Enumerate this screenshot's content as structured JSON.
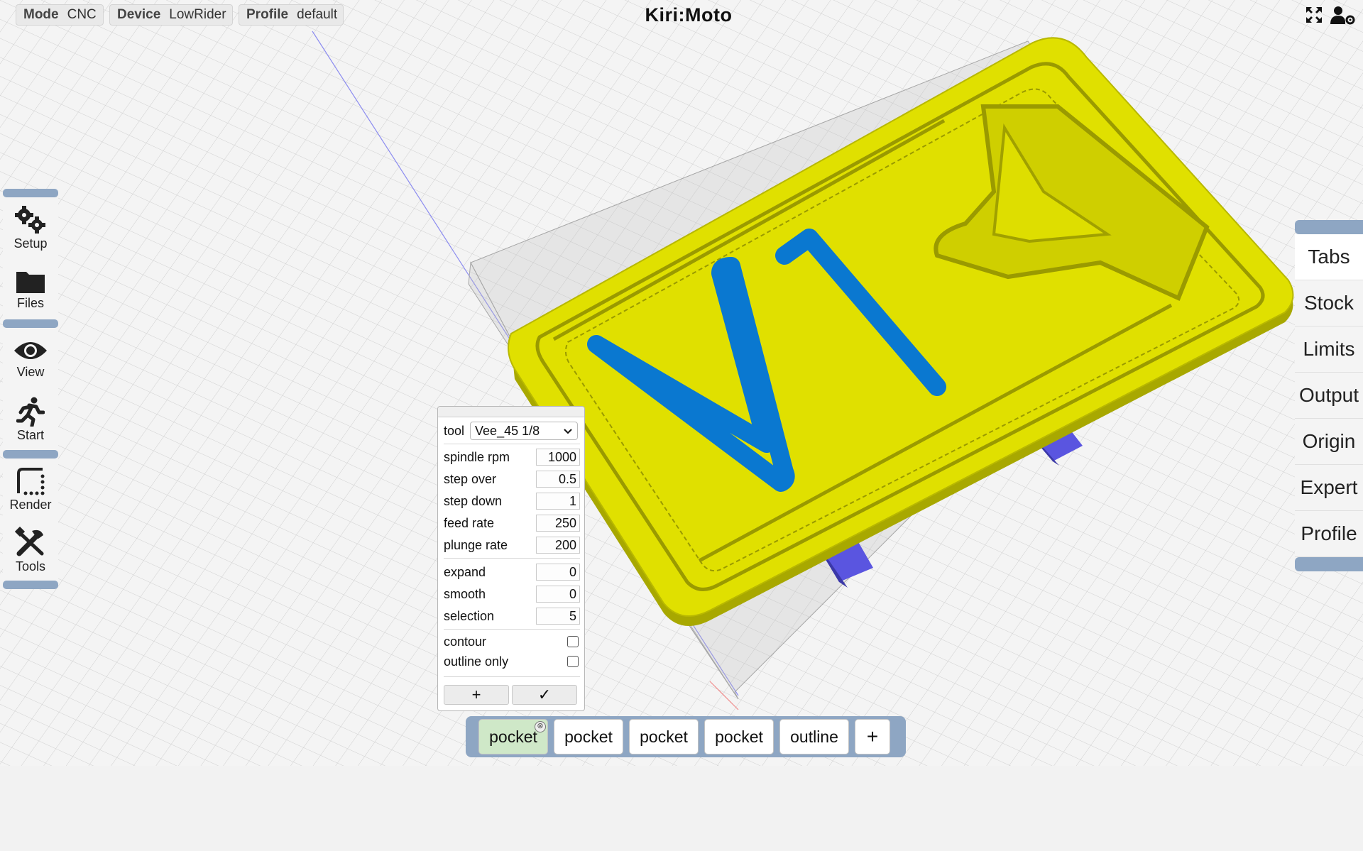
{
  "app": {
    "title": "Kiri:Moto"
  },
  "topbar": {
    "mode": {
      "label": "Mode",
      "value": "CNC"
    },
    "device": {
      "label": "Device",
      "value": "LowRider"
    },
    "profile": {
      "label": "Profile",
      "value": "default"
    },
    "icons": [
      "fullscreen-icon",
      "user-settings-icon"
    ]
  },
  "leftnav": {
    "items": [
      {
        "label": "Setup",
        "icon": "gears-icon"
      },
      {
        "label": "Files",
        "icon": "folder-icon"
      },
      {
        "label": "View",
        "icon": "eye-icon"
      },
      {
        "label": "Start",
        "icon": "running-icon"
      },
      {
        "label": "Render",
        "icon": "render-icon"
      },
      {
        "label": "Tools",
        "icon": "tools-icon"
      }
    ]
  },
  "rightnav": {
    "items": [
      "Tabs",
      "Stock",
      "Limits",
      "Output",
      "Origin",
      "Expert",
      "Profile"
    ]
  },
  "panel": {
    "tool_label": "tool",
    "tool_value": "Vee_45 1/8",
    "fields": [
      {
        "label": "spindle rpm",
        "value": "1000"
      },
      {
        "label": "step over",
        "value": "0.5"
      },
      {
        "label": "step down",
        "value": "1"
      },
      {
        "label": "feed rate",
        "value": "250"
      },
      {
        "label": "plunge rate",
        "value": "200"
      },
      {
        "label": "expand",
        "value": "0"
      },
      {
        "label": "smooth",
        "value": "0"
      },
      {
        "label": "selection",
        "value": "5"
      }
    ],
    "checks": [
      {
        "label": "contour",
        "checked": false
      },
      {
        "label": "outline only",
        "checked": false
      }
    ],
    "add_label": "+",
    "ok_label": "✓"
  },
  "operations": {
    "items": [
      {
        "label": "pocket",
        "active": true
      },
      {
        "label": "pocket",
        "active": false
      },
      {
        "label": "pocket",
        "active": false
      },
      {
        "label": "pocket",
        "active": false
      },
      {
        "label": "outline",
        "active": false
      }
    ],
    "add_label": "+",
    "close_glyph": "⊗"
  },
  "colors": {
    "part": "#e0e000",
    "part_shadow": "#a8a800",
    "engrave": "#0a78d0",
    "tab_blocks": "#5a55e0",
    "accent": "#8ea6c3"
  }
}
